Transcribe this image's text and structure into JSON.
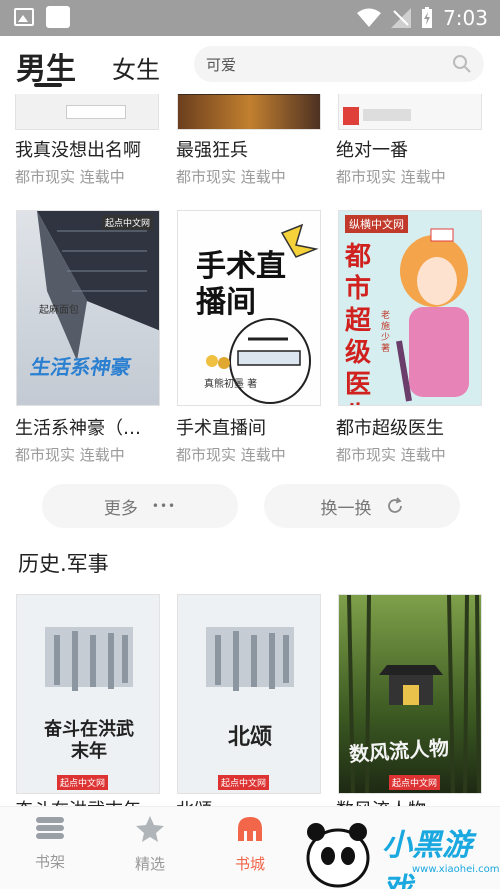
{
  "status_bar": {
    "time": "7:03"
  },
  "header": {
    "tab_male": "男生",
    "tab_female": "女生",
    "search_placeholder": "可爱"
  },
  "books_row1": [
    {
      "title": "我真没想出名啊",
      "meta": "都市现实 连载中"
    },
    {
      "title": "最强狂兵",
      "meta": "都市现实 连载中"
    },
    {
      "title": "绝对一番",
      "meta": "都市现实 连载中"
    }
  ],
  "books_row2": [
    {
      "title": "生活系神豪（…",
      "meta": "都市现实 连载中",
      "cover_text": "生活系神豪",
      "cover_author": "起麻面包"
    },
    {
      "title": "手术直播间",
      "meta": "都市现实 连载中",
      "cover_text": "手术直播间",
      "cover_author": "真熊初墨 著"
    },
    {
      "title": "都市超级医生",
      "meta": "都市现实 连载中",
      "cover_text": "都市超级医生",
      "cover_author": "老施少 著"
    }
  ],
  "actions": {
    "more": "更多",
    "more_dots": "•••",
    "refresh": "换一换"
  },
  "section2": {
    "title": "历史.军事"
  },
  "books_row3": [
    {
      "title": "奋斗在洪武末年",
      "cover_text": "奋斗在洪武末年"
    },
    {
      "title": "北颂",
      "cover_text": "北颂"
    },
    {
      "title": "数风流人物",
      "cover_text": "数风流人物"
    }
  ],
  "cover_brand": "起点中文网",
  "bottom_nav": [
    {
      "label": "书架",
      "icon": "bookshelf-icon"
    },
    {
      "label": "精选",
      "icon": "star-icon"
    },
    {
      "label": "书城",
      "icon": "bookstore-icon",
      "active": true
    }
  ],
  "watermark": {
    "text": "小黑游戏",
    "url": "www.xiaohei.com"
  },
  "colors": {
    "accent": "#f2664a",
    "status_bar": "#9e9e9e"
  }
}
